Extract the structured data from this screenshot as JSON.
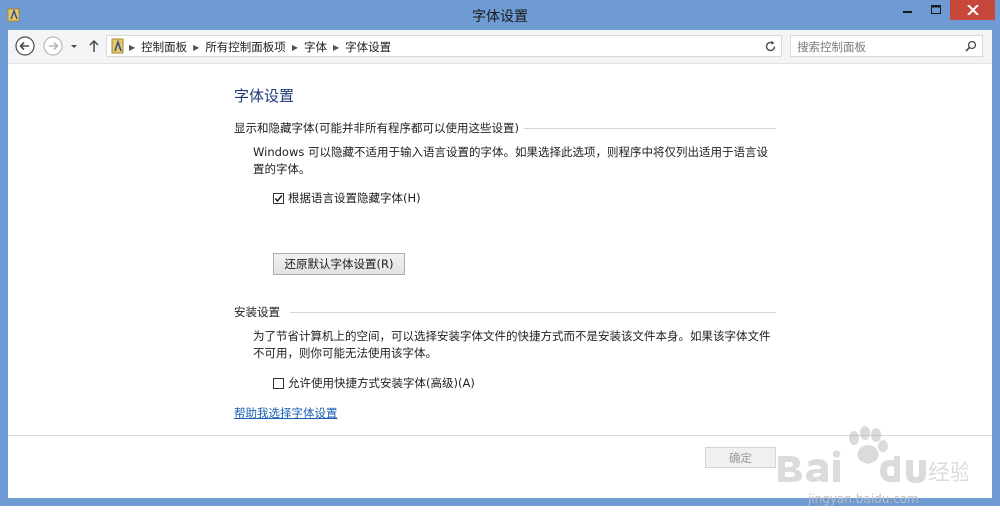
{
  "window": {
    "title": "字体设置"
  },
  "address": {
    "breadcrumbs": [
      "控制面板",
      "所有控制面板项",
      "字体",
      "字体设置"
    ]
  },
  "search": {
    "placeholder": "搜索控制面板"
  },
  "page": {
    "title": "字体设置",
    "section1": {
      "heading": "显示和隐藏字体(可能并非所有程序都可以使用这些设置)",
      "para_line1": "Windows 可以隐藏不适用于输入语言设置的字体。如果选择此选项，则程序中将仅列出适用于语言设",
      "para_line2": "置的字体。",
      "checkbox_label": "根据语言设置隐藏字体(H)",
      "checkbox_checked": true,
      "restore_button": "还原默认字体设置(R)"
    },
    "section2": {
      "heading": "安装设置",
      "para_line1": "为了节省计算机上的空间，可以选择安装字体文件的快捷方式而不是安装该文件本身。如果该字体文件",
      "para_line2": "不可用，则你可能无法使用该字体。",
      "checkbox_label": "允许使用快捷方式安装字体(高级)(A)",
      "checkbox_checked": false
    },
    "help_link": "帮助我选择字体设置"
  },
  "footer": {
    "ok_button": "确定"
  },
  "watermark": {
    "url_text": "jingyan.baidu.com"
  },
  "colors": {
    "titlebar": "#6e9bd3",
    "close_button": "#c7473b",
    "link": "#1a5fb4",
    "page_title": "#1f3a7a"
  }
}
